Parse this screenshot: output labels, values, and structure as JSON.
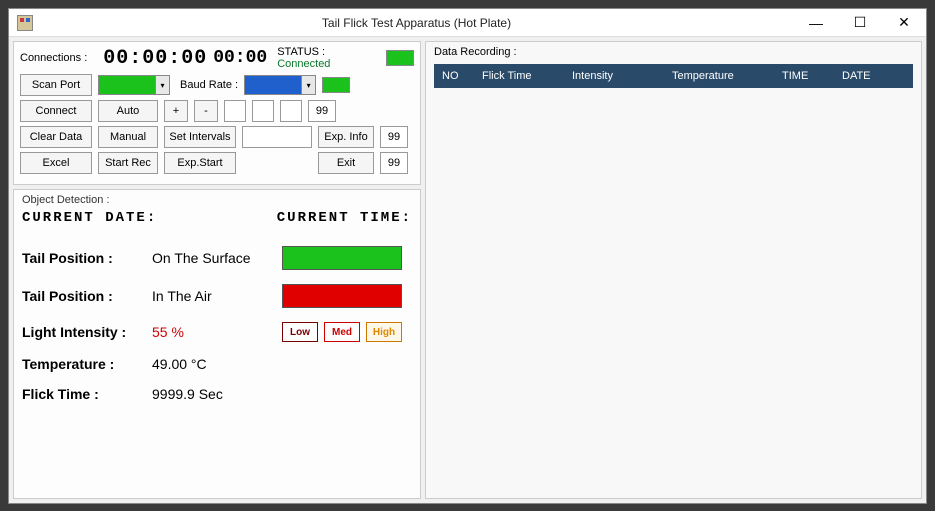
{
  "window": {
    "title": "Tail Flick Test Apparatus (Hot Plate)"
  },
  "connections": {
    "label": "Connections :",
    "timer1": "00:00:00",
    "timer2": "00:00",
    "status_label": "STATUS :",
    "status_value": "Connected",
    "baud_label": "Baud Rate :",
    "buttons": {
      "scan_port": "Scan Port",
      "connect": "Connect",
      "clear_data": "Clear Data",
      "excel": "Excel",
      "auto": "Auto",
      "manual": "Manual",
      "start_rec": "Start Rec",
      "plus": "+",
      "minus": "-",
      "set_intervals": "Set Intervals",
      "exp_start": "Exp.Start",
      "exp_info": "Exp. Info",
      "exit": "Exit"
    },
    "num_vals": {
      "v1": "99",
      "v2": "99",
      "v3": "99"
    }
  },
  "object_detection": {
    "label": "Object Detection :",
    "current_date_label": "CURRENT DATE:",
    "current_time_label": "CURRENT TIME:",
    "tail_pos_label": "Tail Position :",
    "tail_surface": "On The Surface",
    "tail_air": "In The Air",
    "light_intensity_label": "Light Intensity :",
    "light_intensity_value": "55 %",
    "low": "Low",
    "med": "Med",
    "high": "High",
    "temperature_label": "Temperature :",
    "temperature_value": "49.00 °C",
    "flick_time_label": "Flick Time :",
    "flick_time_value": "9999.9 Sec"
  },
  "data_recording": {
    "label": "Data Recording :",
    "headers": {
      "no": "NO",
      "flick_time": "Flick Time",
      "intensity": "Intensity",
      "temperature": "Temperature",
      "time": "TIME",
      "date": "DATE"
    },
    "rows": []
  }
}
